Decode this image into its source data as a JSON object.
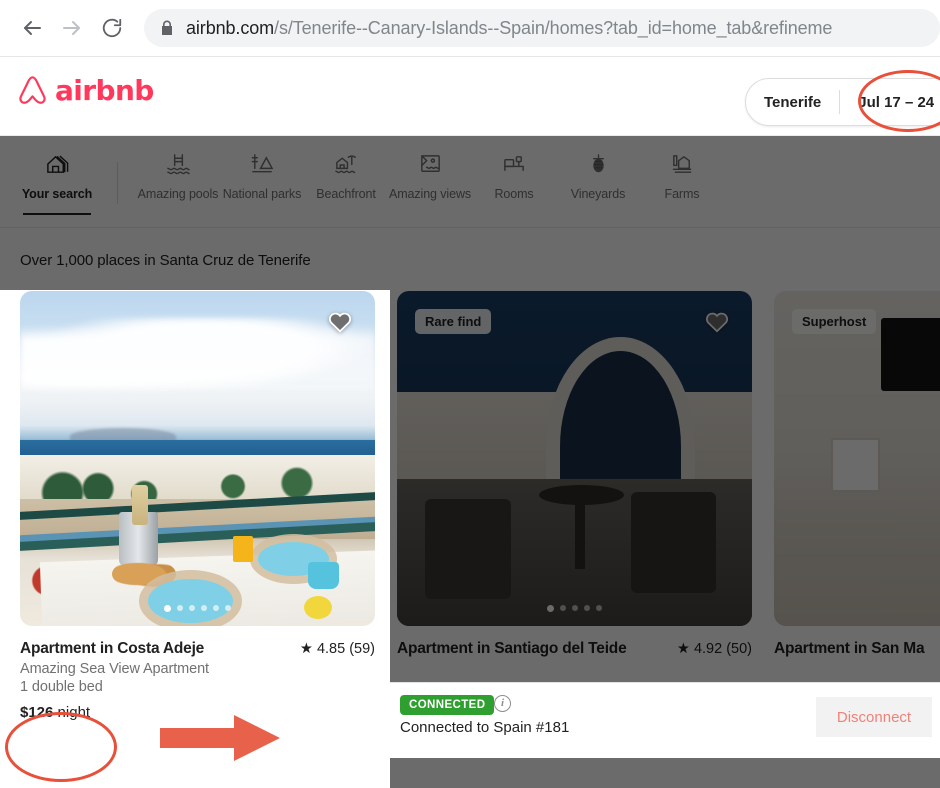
{
  "browser": {
    "back_icon": "arrow-left-icon",
    "forward_icon": "arrow-right-icon",
    "reload_icon": "reload-icon",
    "lock_icon": "lock-icon",
    "url_host": "airbnb.com",
    "url_path": "/s/Tenerife--Canary-Islands--Spain/homes?tab_id=home_tab&refineme"
  },
  "header": {
    "logo_text": "airbnb",
    "logo_color": "#FF385C",
    "search": {
      "location": "Tenerife",
      "dates": "Jul 17 – 24"
    }
  },
  "categories": [
    {
      "label": "Your search",
      "icon": "house-icon",
      "active": true
    },
    {
      "label": "Amazing pools",
      "icon": "pool-icon",
      "active": false
    },
    {
      "label": "National parks",
      "icon": "national-park-icon",
      "active": false
    },
    {
      "label": "Beachfront",
      "icon": "beachfront-icon",
      "active": false
    },
    {
      "label": "Amazing views",
      "icon": "amazing-views-icon",
      "active": false
    },
    {
      "label": "Rooms",
      "icon": "bed-icon",
      "active": false
    },
    {
      "label": "Vineyards",
      "icon": "grapes-icon",
      "active": false
    },
    {
      "label": "Farms",
      "icon": "farm-icon",
      "active": false
    }
  ],
  "results": {
    "heading": "Over 1,000 places in Santa Cruz de Tenerife",
    "listings": [
      {
        "title": "Apartment in Costa Adeje",
        "rating": "★ 4.85 (59)",
        "subtitle": "Amazing Sea View Apartment",
        "beds": "1 double bed",
        "price_amount": "$126",
        "price_unit": "night",
        "badge": "",
        "favorite_icon": "heart-icon",
        "photo_dots": 6,
        "photo_active_dot": 0
      },
      {
        "title": "Apartment in Santiago del Teide",
        "rating": "★ 4.92 (50)",
        "subtitle": "",
        "beds": "",
        "price_amount": "",
        "price_unit": "",
        "badge": "Rare find",
        "favorite_icon": "heart-icon",
        "photo_dots": 5,
        "photo_active_dot": 0
      },
      {
        "title": "Apartment in San Ma",
        "rating": "",
        "subtitle": "",
        "beds": "",
        "price_amount": "",
        "price_unit": "",
        "badge": "Superhost",
        "favorite_icon": "",
        "photo_dots": 0,
        "photo_active_dot": 0
      }
    ]
  },
  "vpn": {
    "status_badge": "CONNECTED",
    "info_icon": "info-icon",
    "status_text": "Connected to Spain #181",
    "disconnect_label": "Disconnect",
    "badge_color": "#2fa02f",
    "disconnect_color": "#f0817a"
  },
  "annotations": {
    "highlight_color": "#e8503a",
    "date_ellipse": "ellipse-around-dates",
    "price_ellipse": "ellipse-around-price",
    "arrow": "arrow-pointing-right"
  }
}
